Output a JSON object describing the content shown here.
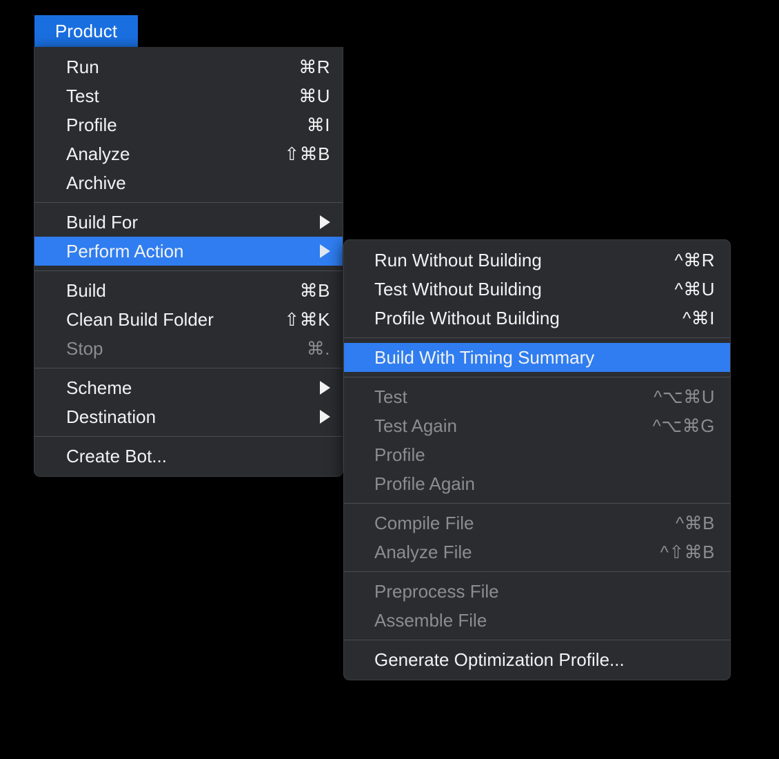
{
  "menubar": {
    "active_item": "Product"
  },
  "theme": {
    "highlight_color": "#2f7df0",
    "menubar_highlight_color": "#1a6fe0",
    "menu_background": "#2a2c2f",
    "text_color": "#f2f2f3",
    "disabled_text_color": "#8a8d91",
    "separator_color": "#4b4e53",
    "page_background": "#000000"
  },
  "product_menu": {
    "sections": [
      {
        "items": [
          {
            "label": "Run",
            "shortcut": "⌘R",
            "disabled": false,
            "selected": false,
            "submenu": false
          },
          {
            "label": "Test",
            "shortcut": "⌘U",
            "disabled": false,
            "selected": false,
            "submenu": false
          },
          {
            "label": "Profile",
            "shortcut": "⌘I",
            "disabled": false,
            "selected": false,
            "submenu": false
          },
          {
            "label": "Analyze",
            "shortcut": "⇧⌘B",
            "disabled": false,
            "selected": false,
            "submenu": false
          },
          {
            "label": "Archive",
            "shortcut": "",
            "disabled": false,
            "selected": false,
            "submenu": false
          }
        ]
      },
      {
        "items": [
          {
            "label": "Build For",
            "shortcut": "",
            "disabled": false,
            "selected": false,
            "submenu": true
          },
          {
            "label": "Perform Action",
            "shortcut": "",
            "disabled": false,
            "selected": true,
            "submenu": true
          }
        ]
      },
      {
        "items": [
          {
            "label": "Build",
            "shortcut": "⌘B",
            "disabled": false,
            "selected": false,
            "submenu": false
          },
          {
            "label": "Clean Build Folder",
            "shortcut": "⇧⌘K",
            "disabled": false,
            "selected": false,
            "submenu": false
          },
          {
            "label": "Stop",
            "shortcut": "⌘.",
            "disabled": true,
            "selected": false,
            "submenu": false
          }
        ]
      },
      {
        "items": [
          {
            "label": "Scheme",
            "shortcut": "",
            "disabled": false,
            "selected": false,
            "submenu": true
          },
          {
            "label": "Destination",
            "shortcut": "",
            "disabled": false,
            "selected": false,
            "submenu": true
          }
        ]
      },
      {
        "items": [
          {
            "label": "Create Bot...",
            "shortcut": "",
            "disabled": false,
            "selected": false,
            "submenu": false
          }
        ]
      }
    ]
  },
  "perform_action_submenu": {
    "sections": [
      {
        "items": [
          {
            "label": "Run Without Building",
            "shortcut": "^⌘R",
            "disabled": false,
            "selected": false,
            "submenu": false
          },
          {
            "label": "Test Without Building",
            "shortcut": "^⌘U",
            "disabled": false,
            "selected": false,
            "submenu": false
          },
          {
            "label": "Profile Without Building",
            "shortcut": "^⌘I",
            "disabled": false,
            "selected": false,
            "submenu": false
          }
        ]
      },
      {
        "items": [
          {
            "label": "Build With Timing Summary",
            "shortcut": "",
            "disabled": false,
            "selected": true,
            "submenu": false
          }
        ]
      },
      {
        "items": [
          {
            "label": "Test",
            "shortcut": "^⌥⌘U",
            "disabled": true,
            "selected": false,
            "submenu": false
          },
          {
            "label": "Test Again",
            "shortcut": "^⌥⌘G",
            "disabled": true,
            "selected": false,
            "submenu": false
          },
          {
            "label": "Profile",
            "shortcut": "",
            "disabled": true,
            "selected": false,
            "submenu": false
          },
          {
            "label": "Profile Again",
            "shortcut": "",
            "disabled": true,
            "selected": false,
            "submenu": false
          }
        ]
      },
      {
        "items": [
          {
            "label": "Compile File",
            "shortcut": "^⌘B",
            "disabled": true,
            "selected": false,
            "submenu": false
          },
          {
            "label": "Analyze File",
            "shortcut": "^⇧⌘B",
            "disabled": true,
            "selected": false,
            "submenu": false
          }
        ]
      },
      {
        "items": [
          {
            "label": "Preprocess File",
            "shortcut": "",
            "disabled": true,
            "selected": false,
            "submenu": false
          },
          {
            "label": "Assemble File",
            "shortcut": "",
            "disabled": true,
            "selected": false,
            "submenu": false
          }
        ]
      },
      {
        "items": [
          {
            "label": "Generate Optimization Profile...",
            "shortcut": "",
            "disabled": false,
            "selected": false,
            "submenu": false
          }
        ]
      }
    ]
  }
}
